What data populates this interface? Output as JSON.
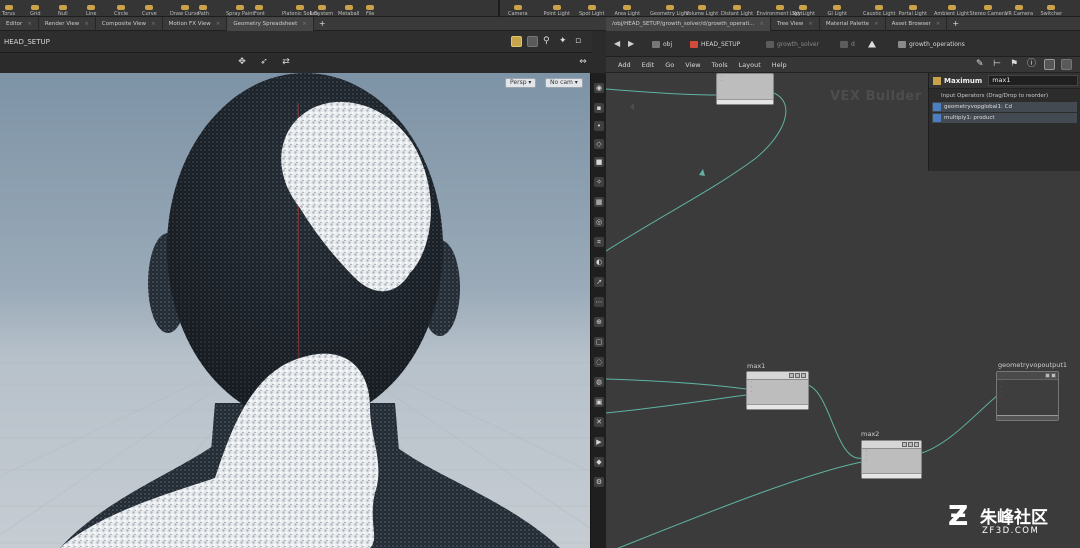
{
  "shelf": {
    "left_tools": [
      "Torus",
      "Grid",
      "Null",
      "Line",
      "Circle",
      "Curve",
      "Draw Curve",
      "Path",
      "Spray Paint",
      "Font",
      "Platonic Solids",
      "L-System",
      "Metaball",
      "File"
    ],
    "right_tools": [
      "Camera",
      "Point Light",
      "Spot Light",
      "Area Light",
      "Geometry Light",
      "Volume Light",
      "Distant Light",
      "Environment Light",
      "Sky Light",
      "GI Light",
      "Caustic Light",
      "Portal Light",
      "Ambient Light",
      "Stereo Camera",
      "VR Camera",
      "Switcher"
    ]
  },
  "left_tabs": [
    {
      "label": "Editor"
    },
    {
      "label": "Render View"
    },
    {
      "label": "Composite View"
    },
    {
      "label": "Motion FX View"
    },
    {
      "label": "Geometry Spreadsheet"
    }
  ],
  "viewer": {
    "path": "HEAD_SETUP",
    "persp_label": "Persp",
    "cam_label": "No cam"
  },
  "right_tabs": [
    {
      "label": "/obj/HEAD_SETUP/growth_solver/d/growth_operati..."
    },
    {
      "label": "Tree View"
    },
    {
      "label": "Material Palette"
    },
    {
      "label": "Asset Browser"
    }
  ],
  "network": {
    "breadcrumbs": [
      "obj",
      "HEAD_SETUP",
      "growth_solver",
      "d",
      "growth_operations"
    ],
    "menu": [
      "Add",
      "Edit",
      "Go",
      "View",
      "Tools",
      "Layout",
      "Help"
    ],
    "watermark": "VEX Builder",
    "nodes": {
      "max1": "max1",
      "max2": "max2",
      "output": "geometryvopoutput1"
    }
  },
  "inputs_panel": {
    "title": "Maximum",
    "name_value": "max1",
    "label": "Input Operators (Drag/Drop to reorder)",
    "items": [
      "geometryvopglobal1: Cd",
      "multiply1: product"
    ]
  },
  "logo": {
    "cn": "朱峰社区",
    "en": "ZF3D.COM"
  },
  "colors": {
    "wire": "#5fb3a4",
    "accent": "#c9a24a",
    "selected_item": "#4b7fc2"
  }
}
